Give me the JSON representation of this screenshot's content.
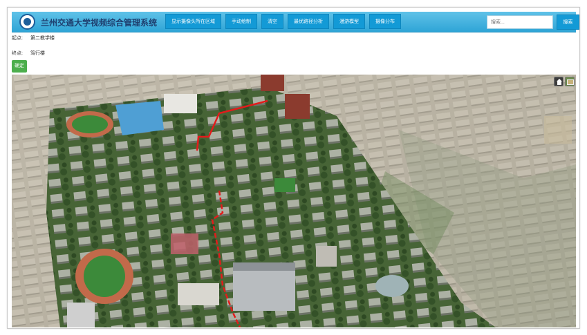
{
  "header": {
    "title": "兰州交通大学视频综合管理系统",
    "nav": [
      "显示摄像头所在区域",
      "手动绘制",
      "清空",
      "最优路径分析",
      "漫游模型",
      "摄像分布"
    ],
    "search_placeholder": "搜索...",
    "search_button": "搜索"
  },
  "route_form": {
    "start_label": "起点:",
    "start_value": "第二教学楼",
    "end_label": "终点:",
    "end_value": "笃行楼",
    "confirm_button": "确定"
  },
  "map": {
    "controls": [
      "home-icon",
      "layer-icon"
    ],
    "route_color": "#e31b1b"
  },
  "colors": {
    "header": "#3fb0de",
    "nav_button": "#139ad6",
    "confirm_button": "#4cae4c"
  }
}
